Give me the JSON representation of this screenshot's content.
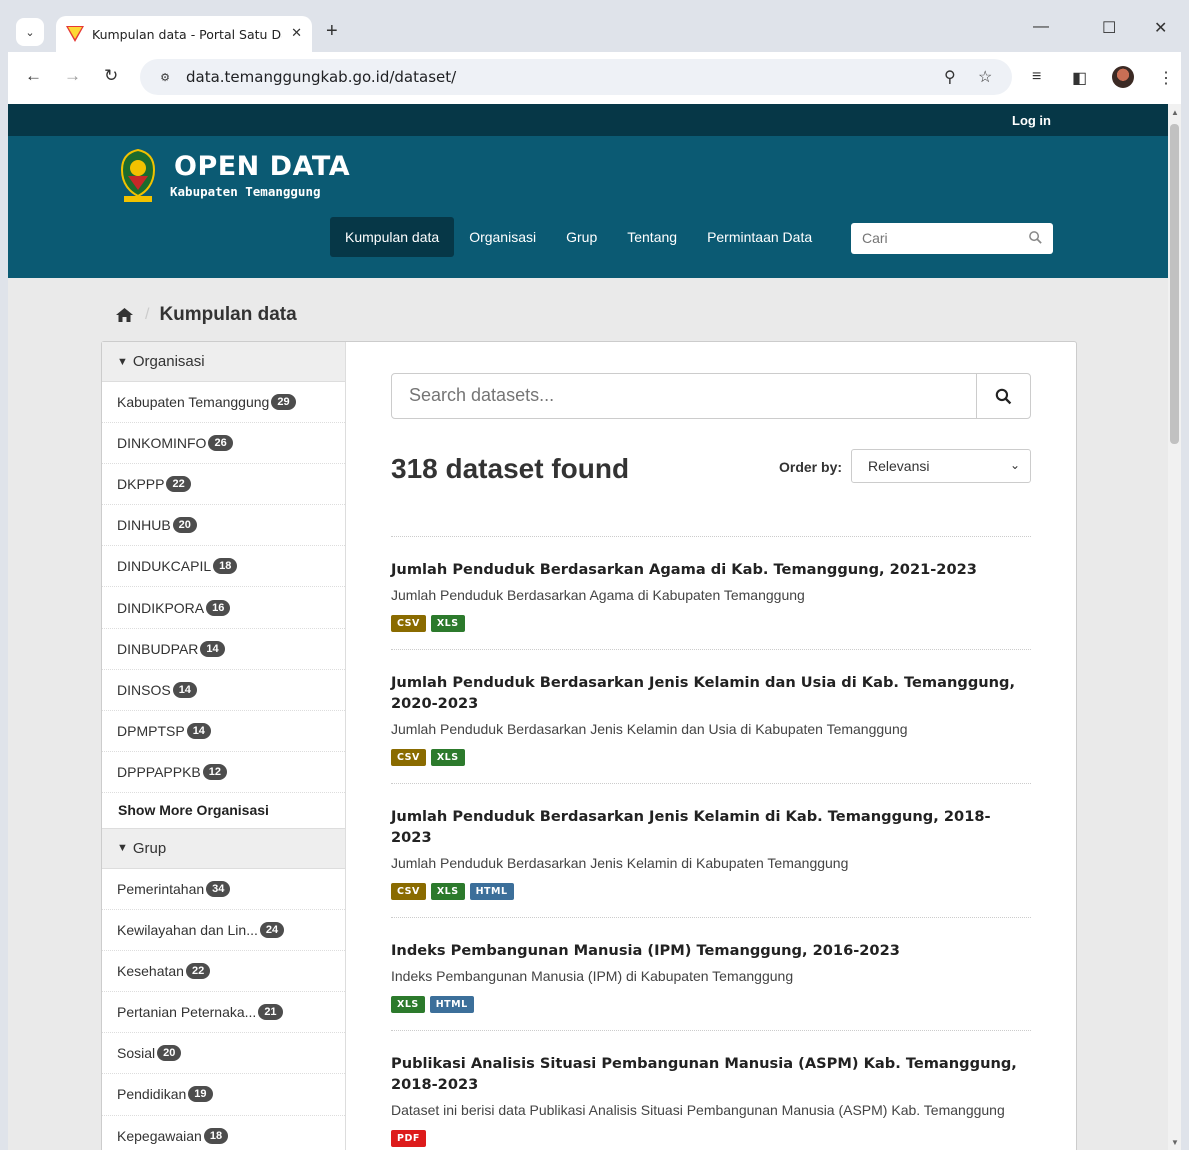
{
  "browser": {
    "tab_title": "Kumpulan data - Portal Satu Da",
    "url": "data.temanggungkab.go.id/dataset/"
  },
  "header": {
    "login": "Log in",
    "logo_title": "OPEN DATA",
    "logo_subtitle": "Kabupaten Temanggung",
    "nav": [
      "Kumpulan data",
      "Organisasi",
      "Grup",
      "Tentang",
      "Permintaan Data"
    ],
    "search_placeholder": "Cari"
  },
  "breadcrumb": {
    "current": "Kumpulan data"
  },
  "facets": {
    "organisasi": {
      "heading": "Organisasi",
      "items": [
        {
          "label": "Kabupaten Temanggung",
          "count": "29"
        },
        {
          "label": "DINKOMINFO",
          "count": "26"
        },
        {
          "label": "DKPPP",
          "count": "22"
        },
        {
          "label": "DINHUB",
          "count": "20"
        },
        {
          "label": "DINDUKCAPIL",
          "count": "18"
        },
        {
          "label": "DINDIKPORA",
          "count": "16"
        },
        {
          "label": "DINBUDPAR",
          "count": "14"
        },
        {
          "label": "DINSOS",
          "count": "14"
        },
        {
          "label": "DPMPTSP",
          "count": "14"
        },
        {
          "label": "DPPPAPPKB",
          "count": "12"
        }
      ],
      "show_more": "Show More Organisasi"
    },
    "grup": {
      "heading": "Grup",
      "items": [
        {
          "label": "Pemerintahan",
          "count": "34"
        },
        {
          "label": "Kewilayahan dan Lin...",
          "count": "24"
        },
        {
          "label": "Kesehatan",
          "count": "22"
        },
        {
          "label": "Pertanian Peternaka...",
          "count": "21"
        },
        {
          "label": "Sosial",
          "count": "20"
        },
        {
          "label": "Pendidikan",
          "count": "19"
        },
        {
          "label": "Kepegawaian",
          "count": "18"
        }
      ]
    }
  },
  "main": {
    "search_placeholder": "Search datasets...",
    "result_count": "318 dataset found",
    "order_label": "Order by:",
    "order_value": "Relevansi",
    "results": [
      {
        "title": "Jumlah Penduduk Berdasarkan Agama di Kab. Temanggung, 2021-2023",
        "desc": "Jumlah Penduduk Berdasarkan Agama di Kabupaten Temanggung",
        "formats": [
          "CSV",
          "XLS"
        ]
      },
      {
        "title": "Jumlah Penduduk Berdasarkan Jenis Kelamin dan Usia di Kab. Temanggung, 2020-2023",
        "desc": "Jumlah Penduduk Berdasarkan Jenis Kelamin dan Usia di Kabupaten Temanggung",
        "formats": [
          "CSV",
          "XLS"
        ]
      },
      {
        "title": "Jumlah Penduduk Berdasarkan Jenis Kelamin di Kab. Temanggung, 2018-2023",
        "desc": "Jumlah Penduduk Berdasarkan Jenis Kelamin di Kabupaten Temanggung",
        "formats": [
          "CSV",
          "XLS",
          "HTML"
        ]
      },
      {
        "title": "Indeks Pembangunan Manusia (IPM) Temanggung, 2016-2023",
        "desc": "Indeks Pembangunan Manusia (IPM) di Kabupaten Temanggung",
        "formats": [
          "XLS",
          "HTML"
        ]
      },
      {
        "title": "Publikasi Analisis Situasi Pembangunan Manusia (ASPM) Kab. Temanggung, 2018-2023",
        "desc": "Dataset ini berisi data Publikasi Analisis Situasi Pembangunan Manusia (ASPM) Kab. Temanggung",
        "formats": [
          "PDF"
        ]
      }
    ]
  }
}
